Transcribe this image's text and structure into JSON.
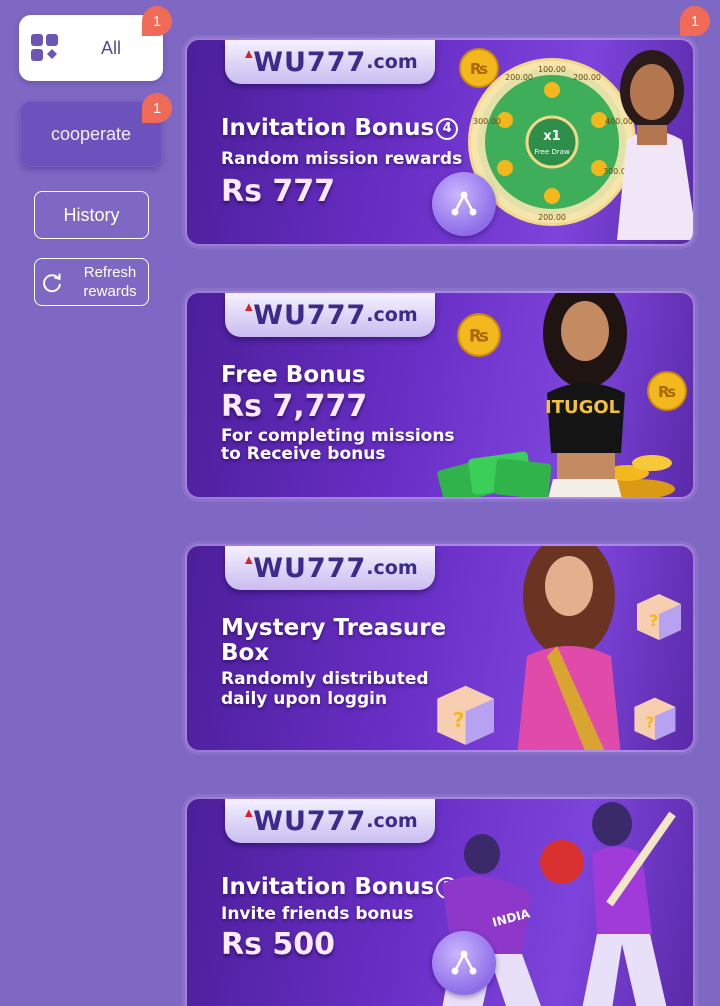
{
  "sidebar": {
    "all_label": "All",
    "all_badge": "1",
    "cooperate_label": "cooperate",
    "cooperate_badge": "1",
    "history_label": "History",
    "refresh_line1": "Refresh",
    "refresh_line2": "rewards"
  },
  "banner_badge": "1",
  "banners": [
    {
      "logo": {
        "brand": "WU777",
        "tld": ".com"
      },
      "title": "Invitation Bonus",
      "title_number": "4",
      "subtitle": "Random mission rewards",
      "amount": "Rs 777",
      "wheel": {
        "center": "x1",
        "center_sub": "Free Draw",
        "labels": [
          "100.00",
          "200.00",
          "200.00",
          "300.00",
          "400.00",
          "200.00",
          "300.00"
        ]
      }
    },
    {
      "logo": {
        "brand": "WU777",
        "tld": ".com"
      },
      "title": "Free Bonus",
      "amount": "Rs 7,777",
      "subtitle_line1": "For completing missions",
      "subtitle_line2": "to Receive bonus",
      "shirt_text": "ITUGOL"
    },
    {
      "logo": {
        "brand": "WU777",
        "tld": ".com"
      },
      "title_line1": "Mystery Treasure",
      "title_line2": "Box",
      "subtitle_line1": "Randomly distributed",
      "subtitle_line2": "daily upon loggin"
    },
    {
      "logo": {
        "brand": "WU777",
        "tld": ".com"
      },
      "title": "Invitation Bonus",
      "title_number": "1",
      "subtitle": "Invite friends bonus",
      "amount": "Rs 500",
      "jersey_text": "INDIA"
    }
  ],
  "colors": {
    "page_bg": "#7e68c4",
    "badge": "#f06a58",
    "banner_purple": "#6a2fc6",
    "coin_gold": "#f2b81e",
    "wheel_green": "#3fae5b"
  }
}
